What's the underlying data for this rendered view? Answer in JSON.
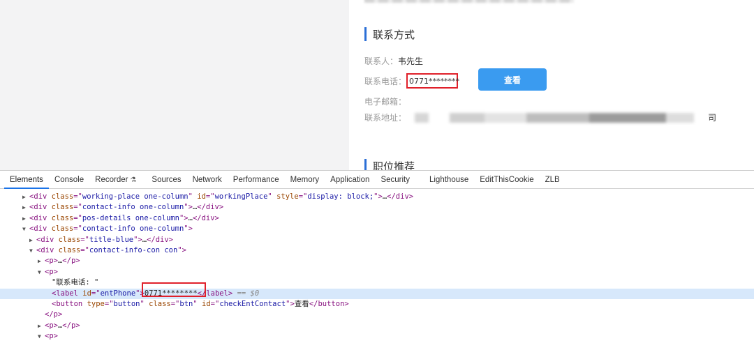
{
  "page": {
    "contact_section_title": "联系方式",
    "jobs_section_title": "职位推荐",
    "contact_person_label": "联系人：",
    "contact_person_value": "韦先生",
    "phone_label": "联系电话：",
    "phone_value": "0771********",
    "view_button_label": "查看",
    "email_label": "电子邮箱：",
    "address_label": "联系地址：",
    "address_tail": "司"
  },
  "devtools": {
    "tabs": [
      {
        "label": "Elements",
        "active": true
      },
      {
        "label": "Console"
      },
      {
        "label": "Recorder"
      },
      {
        "label": "Sources"
      },
      {
        "label": "Network"
      },
      {
        "label": "Performance"
      },
      {
        "label": "Memory"
      },
      {
        "label": "Application"
      },
      {
        "label": "Security"
      },
      {
        "label": "Lighthouse"
      },
      {
        "label": "EditThisCookie"
      },
      {
        "label": "ZLB"
      }
    ],
    "tree": {
      "l1_class": "working-place one-column",
      "l1_id": "workingPlace",
      "l1_style": "display: block;",
      "l2_class": "contact-info one-column",
      "l3_class": "pos-details one-column",
      "l4_class": "contact-info one-column",
      "l5_class": "title-blue",
      "l6_class": "contact-info-con con",
      "l9_text": "\"联系电话: \"",
      "l10_id": "entPhone",
      "l10_text": "0771********",
      "l10_suffix": "== $0",
      "l11_type": "button",
      "l11_class": "btn",
      "l11_id": "checkEntContact",
      "l11_text": "查看"
    }
  }
}
